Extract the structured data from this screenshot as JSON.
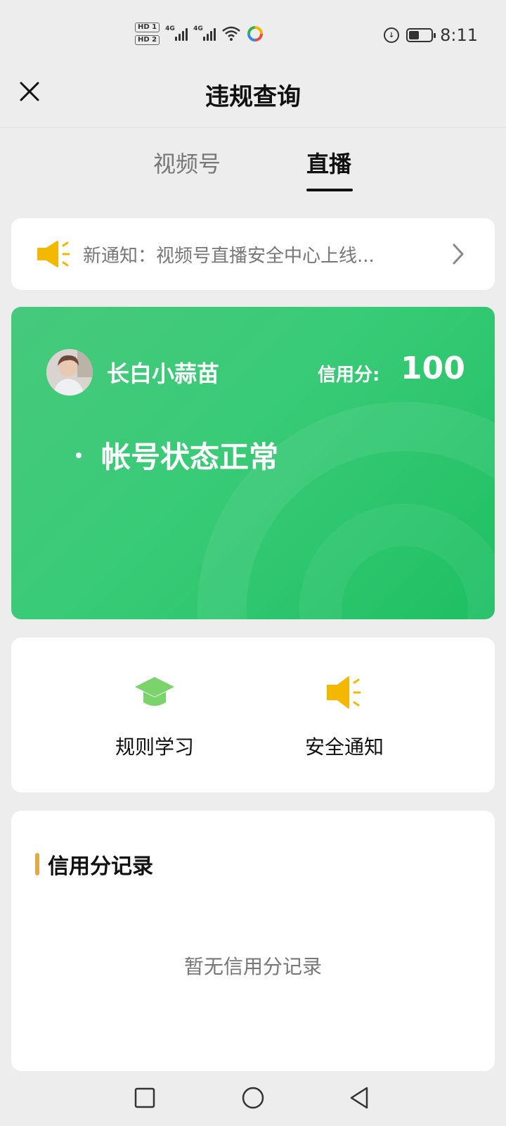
{
  "status_bar": {
    "sim1": "HD 1",
    "sim2": "HD 2",
    "network1": "4G",
    "network2": "4G",
    "time": "8:11",
    "battery_level": 0.45,
    "icons": [
      "signal-icon",
      "wifi-icon",
      "app-sync-icon",
      "data-saver-icon",
      "battery-icon"
    ]
  },
  "header": {
    "title": "违规查询",
    "close_icon": "close-icon"
  },
  "tabs": [
    {
      "label": "视频号",
      "active": false
    },
    {
      "label": "直播",
      "active": true
    }
  ],
  "notice": {
    "text": "新通知：视频号直播安全中心上线...",
    "icon": "speaker-icon",
    "accent_color": "#f5b800"
  },
  "account_card": {
    "user_name": "长白小蒜苗",
    "credit_label": "信用分:",
    "credit_value": "100",
    "status": "帐号状态正常",
    "background_color": "#34c874"
  },
  "actions": [
    {
      "label": "规则学习",
      "icon": "graduation-cap-icon",
      "color": "#7bd46a"
    },
    {
      "label": "安全通知",
      "icon": "speaker-icon",
      "color": "#f5b800"
    }
  ],
  "records": {
    "title": "信用分记录",
    "empty_text": "暂无信用分记录",
    "accent_color": "#e6a64a"
  },
  "system_nav": {
    "recent_icon": "square-icon",
    "home_icon": "circle-icon",
    "back_icon": "triangle-back-icon"
  }
}
